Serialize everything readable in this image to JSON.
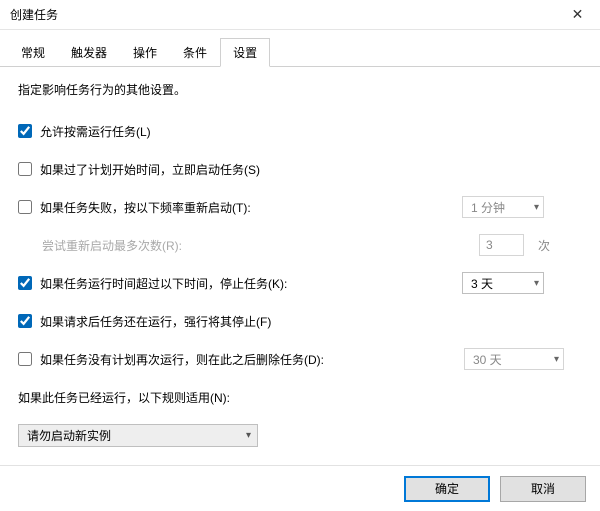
{
  "window": {
    "title": "创建任务"
  },
  "tabs": [
    {
      "label": "常规",
      "active": false
    },
    {
      "label": "触发器",
      "active": false
    },
    {
      "label": "操作",
      "active": false
    },
    {
      "label": "条件",
      "active": false
    },
    {
      "label": "设置",
      "active": true
    }
  ],
  "desc": "指定影响任务行为的其他设置。",
  "opts": {
    "allow_on_demand": {
      "checked": true,
      "label": "允许按需运行任务(L)"
    },
    "run_asap": {
      "checked": false,
      "label": "如果过了计划开始时间，立即启动任务(S)"
    },
    "restart_on_fail": {
      "checked": false,
      "label": "如果任务失败，按以下频率重新启动(T):",
      "interval": "1 分钟"
    },
    "restart_attempts": {
      "label": "尝试重新启动最多次数(R):",
      "value": "3",
      "suffix": "次"
    },
    "stop_if_longer": {
      "checked": true,
      "label": "如果任务运行时间超过以下时间，停止任务(K):",
      "value": "3 天"
    },
    "force_stop": {
      "checked": true,
      "label": "如果请求后任务还在运行，强行将其停止(F)"
    },
    "delete_after": {
      "checked": false,
      "label": "如果任务没有计划再次运行，则在此之后删除任务(D):",
      "value": "30 天"
    },
    "already_running_label": "如果此任务已经运行，以下规则适用(N):",
    "already_running_rule": "请勿启动新实例"
  },
  "buttons": {
    "ok": "确定",
    "cancel": "取消"
  }
}
